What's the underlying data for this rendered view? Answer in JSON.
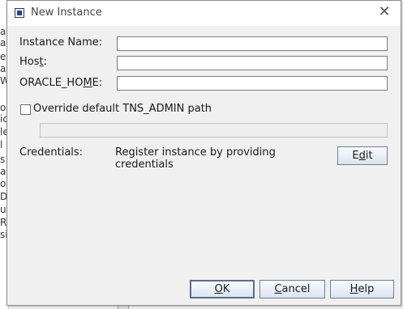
{
  "background": {
    "left_fragments": [
      "ag",
      "ag",
      "es",
      "ag",
      "W",
      "",
      "op",
      "ic",
      "le",
      "l",
      "s",
      "a",
      "os",
      "D",
      "ur",
      "R",
      "si"
    ]
  },
  "dialog": {
    "title": "New Instance",
    "close_symbol": "✕",
    "fields": [
      {
        "label_pre": "Instance Name",
        "mnemonic": "",
        "label_post": ":",
        "value": "",
        "placeholder": ""
      },
      {
        "label_pre": "Hos",
        "mnemonic": "t",
        "label_post": ":",
        "value": "",
        "placeholder": ""
      },
      {
        "label_pre": "ORACLE_HO",
        "mnemonic": "M",
        "label_post": "E:",
        "value": "",
        "placeholder": ""
      }
    ],
    "override": {
      "label": "Override default TNS_ADMIN path",
      "checked": false,
      "path_value": ""
    },
    "credentials": {
      "label": "Credentials:",
      "value_line1": "Register instance by providing",
      "value_line2": "credentials",
      "edit_button_pre": "E",
      "edit_button_mnemonic": "d",
      "edit_button_post": "it"
    },
    "buttons": {
      "ok_mnemonic": "O",
      "ok_rest": "K",
      "cancel_mnemonic": "C",
      "cancel_rest": "ancel",
      "help_mnemonic": "H",
      "help_rest": "elp"
    }
  }
}
